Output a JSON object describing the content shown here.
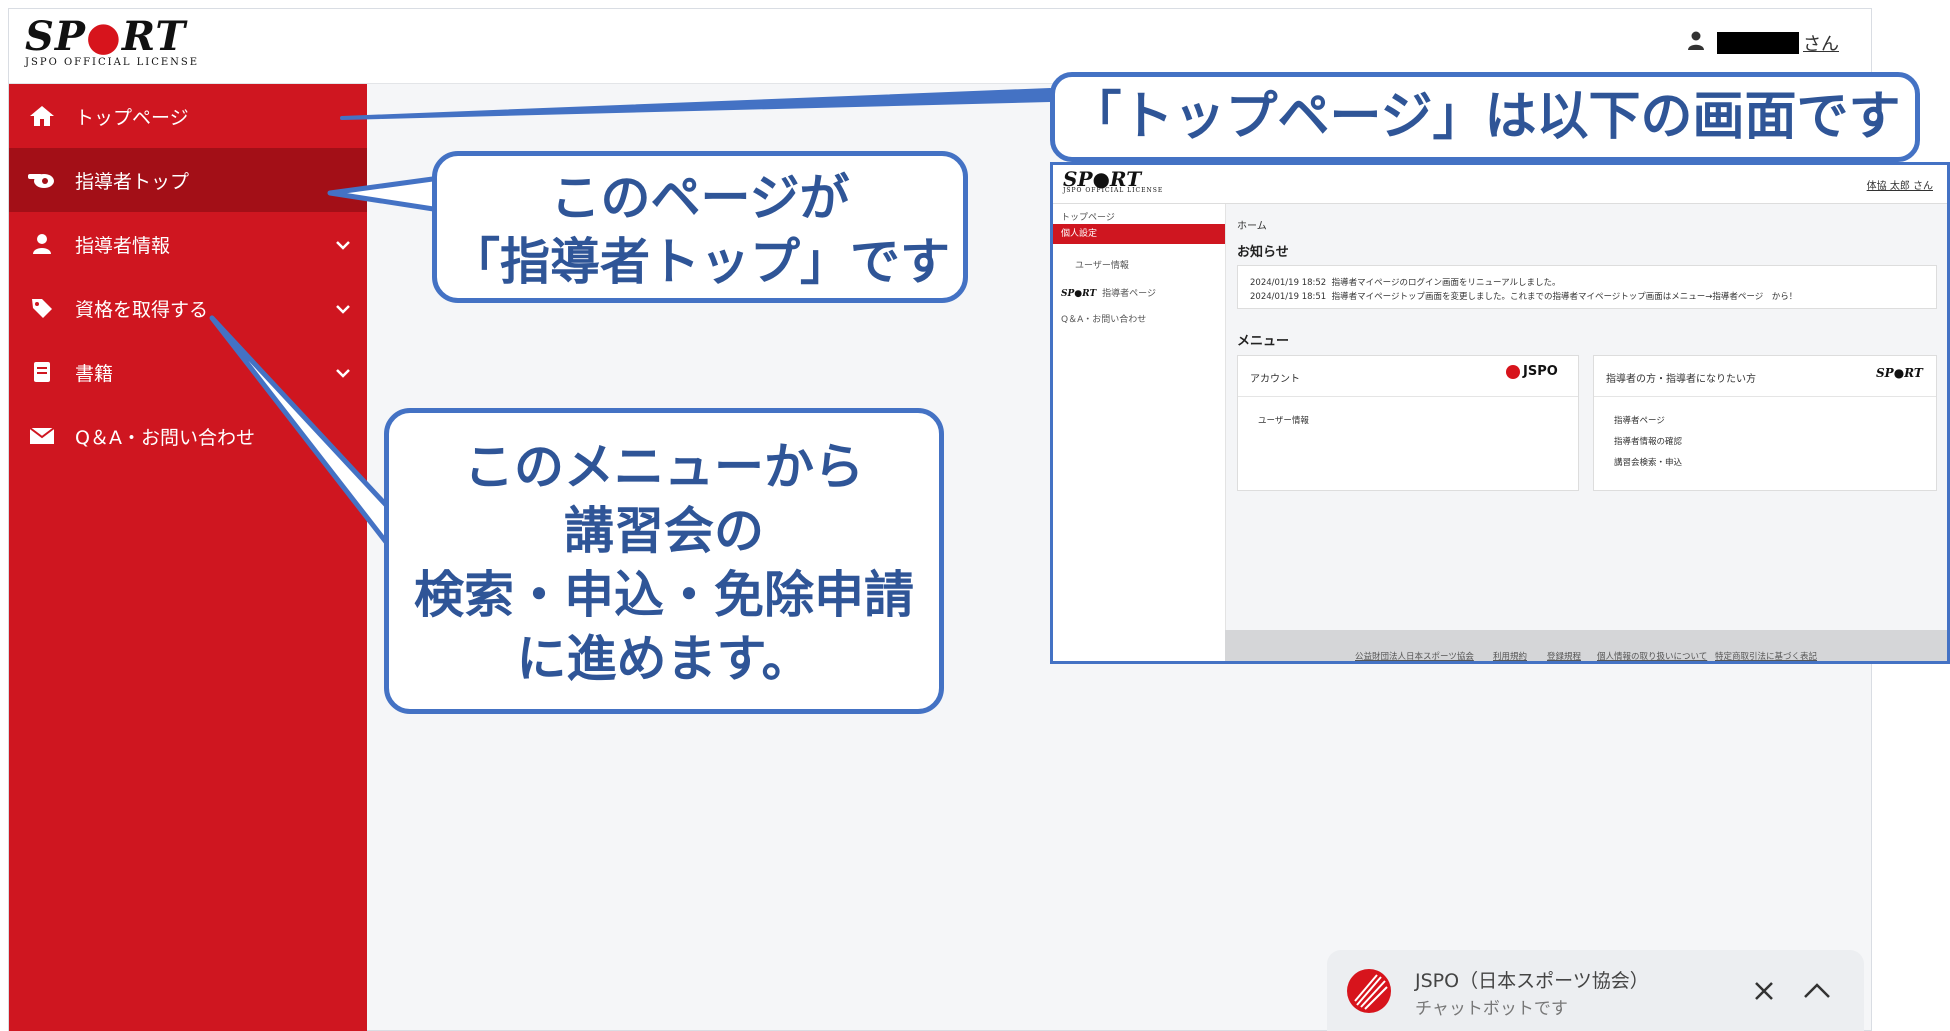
{
  "header": {
    "logo_text_left": "SP",
    "logo_text_dot": "●",
    "logo_text_right": "RT",
    "logo_subtitle": "JSPO OFFICIAL LICENSE",
    "user_suffix": "さん"
  },
  "sidebar": {
    "items": [
      {
        "label": "トップページ",
        "icon": "home-icon"
      },
      {
        "label": "指導者トップ",
        "icon": "whistle-icon"
      },
      {
        "label": "指導者情報",
        "icon": "person-icon"
      },
      {
        "label": "資格を取得する",
        "icon": "tag-icon"
      },
      {
        "label": "書籍",
        "icon": "book-icon"
      },
      {
        "label": "Q＆A・お問い合わせ",
        "icon": "mail-icon"
      }
    ]
  },
  "callouts": {
    "title": "「トップページ」は以下の画面です",
    "shidosha_line1": "このページが",
    "shidosha_line2": "「指導者トップ」です",
    "menu_line1": "このメニューから",
    "menu_line2": "講習会の",
    "menu_line3": "検索・申込・免除申請",
    "menu_line4": "に進めます。"
  },
  "preview": {
    "logo": "SP●RT",
    "logo_sub": "JSPO OFFICIAL LICENSE",
    "user": "体協 太郎 さん",
    "side_top": "トップページ",
    "side_personal": "個人設定",
    "side_user_info": "ユーザー情報",
    "side_shidosha": "指導者ページ",
    "side_qa": "Q＆A・お問い合わせ",
    "breadcrumb": "ホーム",
    "news_heading": "お知らせ",
    "news": [
      {
        "date": "2024/01/19 18:52",
        "text": "指導者マイページのログイン画面をリニューアルしました。"
      },
      {
        "date": "2024/01/19 18:51",
        "text": "指導者マイページトップ画面を変更しました。これまでの指導者マイページトップ画面はメニュー→指導者ページ　から！"
      }
    ],
    "menu_heading": "メニュー",
    "account_card": {
      "title": "アカウント",
      "brand": "JSPO",
      "links": [
        "ユーザー情報"
      ]
    },
    "shidosha_card": {
      "title": "指導者の方・指導者になりたい方",
      "brand": "SP●RT",
      "links": [
        "指導者ページ",
        "指導者情報の確認",
        "講習会検索・申込"
      ]
    },
    "footer_links": [
      "公益財団法人日本スポーツ協会",
      "利用規約",
      "登録規程",
      "個人情報の取り扱いについて",
      "特定商取引法に基づく表記"
    ]
  },
  "chat": {
    "name": "JSPO（日本スポーツ協会）",
    "subtitle": "チャットボットです"
  },
  "colors": {
    "sidebar": "#cf1620",
    "sidebar_active": "#a30f17",
    "callout_border": "#4472c4",
    "callout_text": "#2f5597"
  }
}
